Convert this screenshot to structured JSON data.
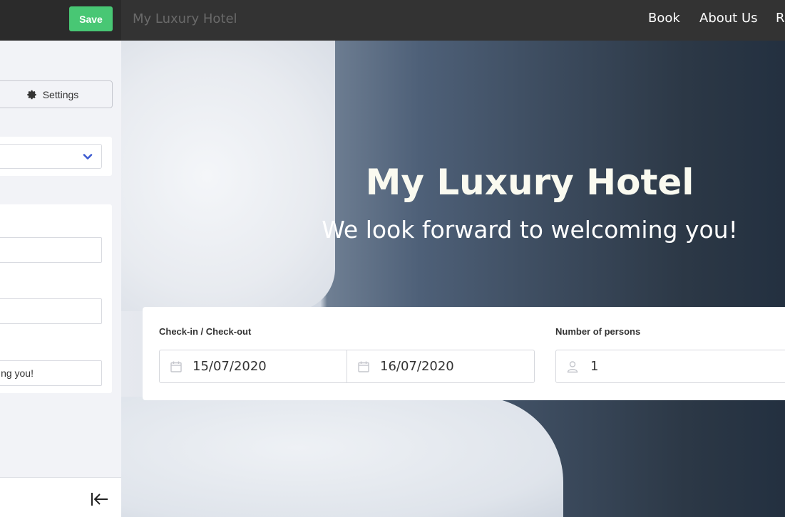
{
  "topbar": {
    "save_label": "Save",
    "site_title": "My Luxury Hotel",
    "nav": [
      "Book",
      "About Us",
      "R"
    ]
  },
  "panel": {
    "settings_label": "Settings",
    "field3_value": "ng you!"
  },
  "hero": {
    "title": "My Luxury Hotel",
    "subtitle": "We look forward to welcoming you!"
  },
  "booking": {
    "dates_label": "Check-in / Check-out",
    "checkin": "15/07/2020",
    "checkout": "16/07/2020",
    "persons_label": "Number of persons",
    "persons": "1"
  },
  "colors": {
    "accent_green": "#48c774",
    "topbar": "#333333",
    "chevron_blue": "#3e5cd1"
  },
  "icons": [
    "gear-icon",
    "chevron-down-icon",
    "collapse-left-icon",
    "calendar-icon",
    "person-icon"
  ]
}
